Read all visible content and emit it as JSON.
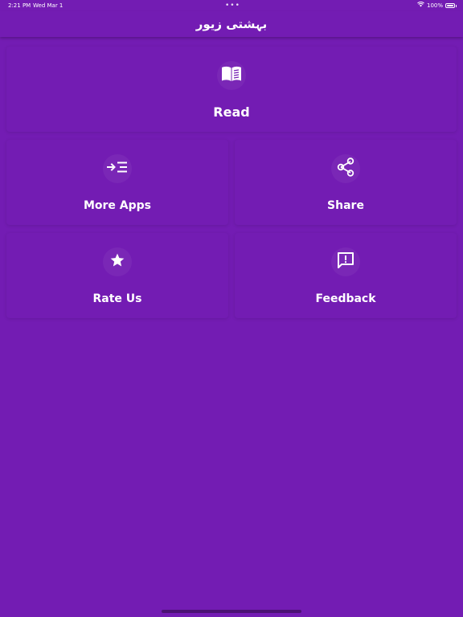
{
  "status_bar": {
    "time": "2:21 PM",
    "date": "Wed Mar 1",
    "dots": "•••",
    "battery_text": "100%",
    "battery_level_percent": 100
  },
  "app_bar": {
    "title": "بہشتی زیور"
  },
  "colors": {
    "background": "#731cb3",
    "text": "#ffffff"
  },
  "menu": {
    "read": {
      "label": "Read",
      "icon": "book-open-icon"
    },
    "more_apps": {
      "label": "More Apps",
      "icon": "more-apps-icon"
    },
    "share": {
      "label": "Share",
      "icon": "share-icon"
    },
    "rate_us": {
      "label": "Rate Us",
      "icon": "star-icon"
    },
    "feedback": {
      "label": "Feedback",
      "icon": "feedback-icon"
    }
  }
}
